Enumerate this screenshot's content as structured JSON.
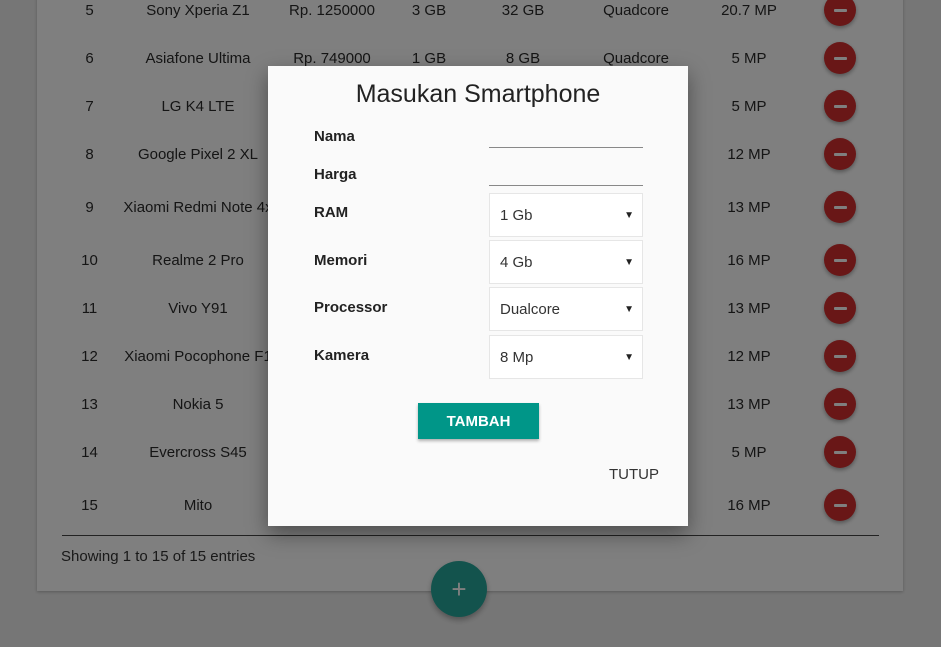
{
  "table": {
    "rows": [
      {
        "no": "5",
        "name": "Sony Xperia Z1",
        "price": "Rp. 1250000",
        "ram": "3 GB",
        "memory": "32 GB",
        "processor": "Quadcore",
        "camera": "20.7 MP"
      },
      {
        "no": "6",
        "name": "Asiafone Ultima",
        "price": "Rp. 749000",
        "ram": "1 GB",
        "memory": "8 GB",
        "processor": "Quadcore",
        "camera": "5 MP"
      },
      {
        "no": "7",
        "name": "LG K4 LTE",
        "price": "",
        "ram": "",
        "memory": "",
        "processor": "",
        "camera": "5 MP"
      },
      {
        "no": "8",
        "name": "Google Pixel 2 XL",
        "price": "",
        "ram": "",
        "memory": "",
        "processor": "",
        "camera": "12 MP"
      },
      {
        "no": "9",
        "name": "Xiaomi Redmi Note 4x",
        "price": "",
        "ram": "",
        "memory": "",
        "processor": "",
        "camera": "13 MP"
      },
      {
        "no": "10",
        "name": "Realme 2 Pro",
        "price": "",
        "ram": "",
        "memory": "",
        "processor": "",
        "camera": "16 MP"
      },
      {
        "no": "11",
        "name": "Vivo Y91",
        "price": "",
        "ram": "",
        "memory": "",
        "processor": "",
        "camera": "13 MP"
      },
      {
        "no": "12",
        "name": "Xiaomi Pocophone F1",
        "price": "",
        "ram": "",
        "memory": "",
        "processor": "",
        "camera": "12 MP"
      },
      {
        "no": "13",
        "name": "Nokia 5",
        "price": "",
        "ram": "",
        "memory": "",
        "processor": "",
        "camera": "13 MP"
      },
      {
        "no": "14",
        "name": "Evercross S45",
        "price": "",
        "ram": "",
        "memory": "",
        "processor": "",
        "camera": "5 MP"
      },
      {
        "no": "15",
        "name": "Mito",
        "price": "",
        "ram": "",
        "memory": "",
        "processor": "",
        "camera": "16 MP"
      }
    ],
    "delete_icon": "minus-circle-icon",
    "delete_color": "#d32f2f"
  },
  "footer": {
    "info": "Showing 1 to 15 of 15 entries"
  },
  "fab": {
    "icon": "plus-icon",
    "label": "+",
    "color": "#26a69a"
  },
  "modal": {
    "title": "Masukan Smartphone",
    "fields": {
      "nama": {
        "label": "Nama",
        "value": ""
      },
      "harga": {
        "label": "Harga",
        "value": ""
      },
      "ram": {
        "label": "RAM",
        "selected": "1 Gb"
      },
      "memori": {
        "label": "Memori",
        "selected": "4 Gb"
      },
      "processor": {
        "label": "Processor",
        "selected": "Dualcore"
      },
      "kamera": {
        "label": "Kamera",
        "selected": "8 Mp"
      }
    },
    "submit_label": "TAMBAH",
    "submit_color": "#009688",
    "close_label": "TUTUP"
  }
}
